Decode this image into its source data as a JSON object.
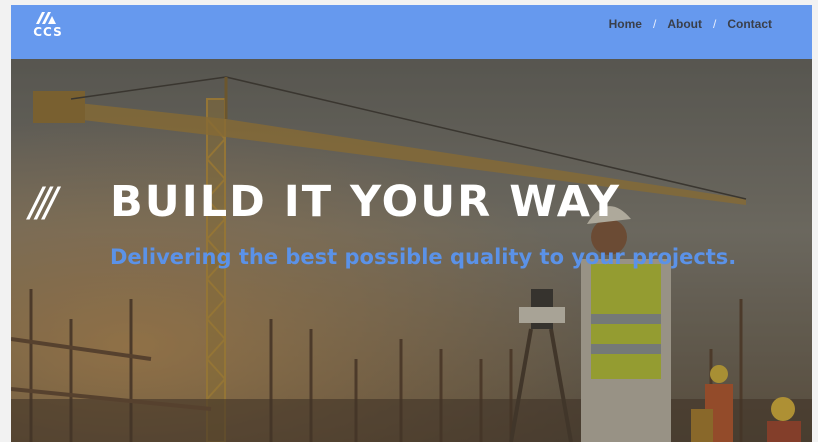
{
  "brand": {
    "logo_text": "CCS",
    "accent": "#6699ee"
  },
  "nav": {
    "items": [
      "Home",
      "About",
      "Contact"
    ],
    "separator": "/"
  },
  "hero": {
    "slashes": "///",
    "title": "BUILD IT YOUR WAY",
    "subtitle": "Delivering the best possible quality to your projects.",
    "subtitle_color": "#5b92e8"
  }
}
